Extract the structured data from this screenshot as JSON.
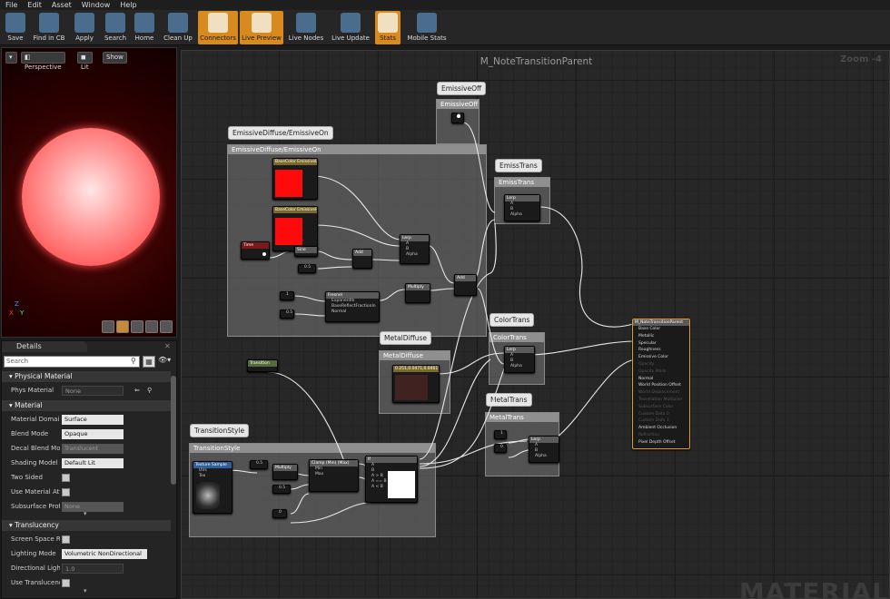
{
  "menu": [
    "File",
    "Edit",
    "Asset",
    "Window",
    "Help"
  ],
  "toolbar": [
    {
      "label": "Save",
      "icon": "save-icon",
      "active": false
    },
    {
      "label": "Find in CB",
      "icon": "find-icon",
      "active": false
    },
    {
      "label": "Apply",
      "icon": "apply-icon",
      "active": false
    },
    {
      "label": "Search",
      "icon": "search-icon",
      "active": false
    },
    {
      "label": "Home",
      "icon": "home-icon",
      "active": false
    },
    {
      "label": "Clean Up",
      "icon": "cleanup-icon",
      "active": false
    },
    {
      "label": "Connectors",
      "icon": "connectors-icon",
      "active": true
    },
    {
      "label": "Live Preview",
      "icon": "live-preview-icon",
      "active": true
    },
    {
      "label": "Live Nodes",
      "icon": "live-nodes-icon",
      "active": false
    },
    {
      "label": "Live Update",
      "icon": "live-update-icon",
      "active": false
    },
    {
      "label": "Stats",
      "icon": "stats-icon",
      "active": true
    },
    {
      "label": "Mobile Stats",
      "icon": "mobile-stats-icon",
      "active": false
    }
  ],
  "viewport": {
    "perspective": "Perspective",
    "lit": "Lit",
    "show": "Show",
    "axis_x": "X",
    "axis_y": "Y",
    "axis_z": "Z"
  },
  "details": {
    "tab": "Details",
    "search_placeholder": "Search",
    "physical_material": {
      "title": "Physical Material",
      "phys_label": "Phys Material",
      "phys_value": "None"
    },
    "material": {
      "title": "Material",
      "rows": [
        {
          "label": "Material Domain",
          "value": "Surface"
        },
        {
          "label": "Blend Mode",
          "value": "Opaque"
        },
        {
          "label": "Decal Blend Mode",
          "value": "Translucent"
        },
        {
          "label": "Shading Model",
          "value": "Default Lit"
        },
        {
          "label": "Two Sided",
          "value": ""
        },
        {
          "label": "Use Material Attributes",
          "value": ""
        },
        {
          "label": "Subsurface Profile",
          "value": "None"
        }
      ]
    },
    "translucency": {
      "title": "Translucency",
      "rows": [
        {
          "label": "Screen Space Reflections",
          "value": ""
        },
        {
          "label": "Lighting Mode",
          "value": "Volumetric NonDirectional"
        },
        {
          "label": "Directional Lighting Intensity",
          "value": "1.0"
        },
        {
          "label": "Use Translucency Vertex Fog",
          "value": ""
        }
      ]
    }
  },
  "graph": {
    "title": "M_NoteTransitionParent",
    "zoom": "Zoom -4",
    "watermark": "MATERIAL",
    "comments": [
      {
        "tag": "EmissiveOff",
        "title": "EmissiveOff"
      },
      {
        "tag": "EmissiveDiffuse/EmissiveOn",
        "title": "EmissiveDiffuse/EmissiveOn"
      },
      {
        "tag": "EmissTrans",
        "title": "EmissTrans"
      },
      {
        "tag": "ColorTrans",
        "title": "ColorTrans"
      },
      {
        "tag": "MetalDiffuse",
        "title": "MetalDiffuse"
      },
      {
        "tag": "MetalTrans",
        "title": "MetalTrans"
      },
      {
        "tag": "TransitionStyle",
        "title": "TransitionStyle"
      }
    ],
    "nodes": {
      "lerp": "Lerp",
      "add": "Add",
      "multiply": "Multiply",
      "sine": "Sine",
      "time": "Time",
      "fresnel": "Fresnel",
      "texture_sample": "Texture Sample",
      "clamp": "Clamp (Min) (Max)",
      "if": "If",
      "transition": "Transition",
      "metal_diffuse_value": "0.251,0.0471,0.0461",
      "result": "M_NoteTransitionParent",
      "pins_lerp": [
        "A",
        "B",
        "Alpha"
      ],
      "pins_add": [
        "A",
        "B"
      ],
      "pins_fresnel": [
        "ExponentIn",
        "BaseReflectFractionIn",
        "Normal"
      ],
      "pins_clamp": [
        "Min",
        "Max"
      ],
      "pins_if": [
        "A",
        "B",
        "A > B",
        "A == B",
        "A < B"
      ],
      "pins_tex": [
        "UVs",
        "Tex"
      ],
      "result_pins": [
        "Base Color",
        "Metallic",
        "Specular",
        "Roughness",
        "Emissive Color",
        "Opacity",
        "Opacity Mask",
        "Normal",
        "World Position Offset",
        "World Displacement",
        "Tessellation Multiplier",
        "Subsurface Color",
        "Custom Data 0",
        "Custom Data 1",
        "Ambient Occlusion",
        "Refraction",
        "Pixel Depth Offset"
      ],
      "emissive_low": "BaseColor EmissiveLow",
      "emissive_high": "BaseColor EmissiveHigh",
      "const_values": [
        "0",
        "0.5",
        "0",
        "1",
        "0.5",
        "0",
        "1",
        "0",
        "0.5",
        "0.5",
        "0"
      ]
    }
  }
}
